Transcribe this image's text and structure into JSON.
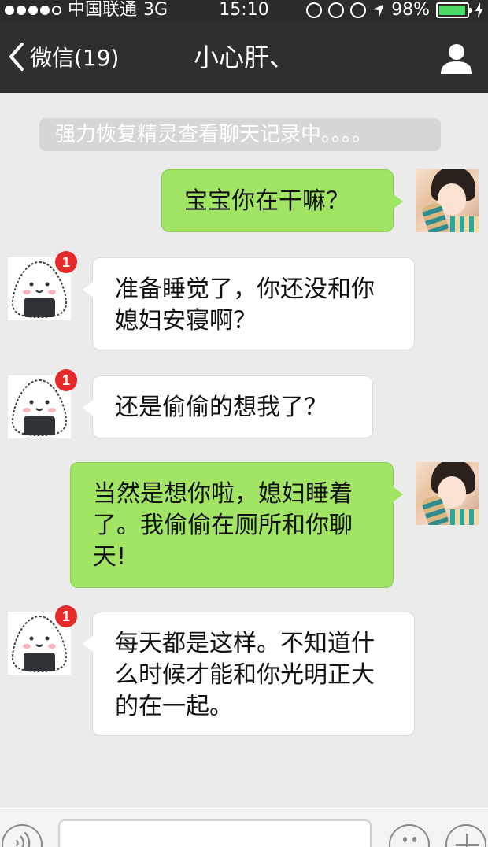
{
  "status_bar": {
    "carrier": "中国联通",
    "network": "3G",
    "time": "15:10",
    "battery_percent": "98%",
    "battery_level": 0.98,
    "icons": [
      "signal-dots-icon",
      "orientation-lock-icon",
      "lock-rotation-icon",
      "alarm-icon",
      "location-arrow-icon",
      "battery-icon",
      "charging-bolt-icon"
    ]
  },
  "nav": {
    "back_label": "微信(19)",
    "title": "小心肝、",
    "profile_icon": "person-icon"
  },
  "system_notice": "强力恢复精灵查看聊天记录中。。。。",
  "messages": [
    {
      "side": "out",
      "text": "宝宝你在干嘛？"
    },
    {
      "side": "in",
      "badge": "1",
      "text_lines": [
        "准备睡觉了，你还没和你",
        "媳妇安寝啊？"
      ]
    },
    {
      "side": "in",
      "badge": "1",
      "text": "还是偷偷的想我了？"
    },
    {
      "side": "out",
      "text_lines": [
        "当然是想你啦，媳妇睡着",
        "了。我偷偷在厕所和你聊",
        "天!"
      ]
    },
    {
      "side": "in",
      "badge": "1",
      "text_lines": [
        "每天都是这样。不知道什",
        "么时候才能和你光明正大",
        "的在一起。"
      ]
    }
  ],
  "colors": {
    "nav_background": "#2f2f2f",
    "chat_background": "#ebebeb",
    "outgoing_bubble": "#a2e565",
    "incoming_bubble": "#ffffff",
    "badge": "#e52a2a",
    "battery_fill": "#4cd964"
  },
  "toolbar": {
    "icons": [
      "voice-icon",
      "emoji-icon",
      "plus-icon"
    ]
  }
}
